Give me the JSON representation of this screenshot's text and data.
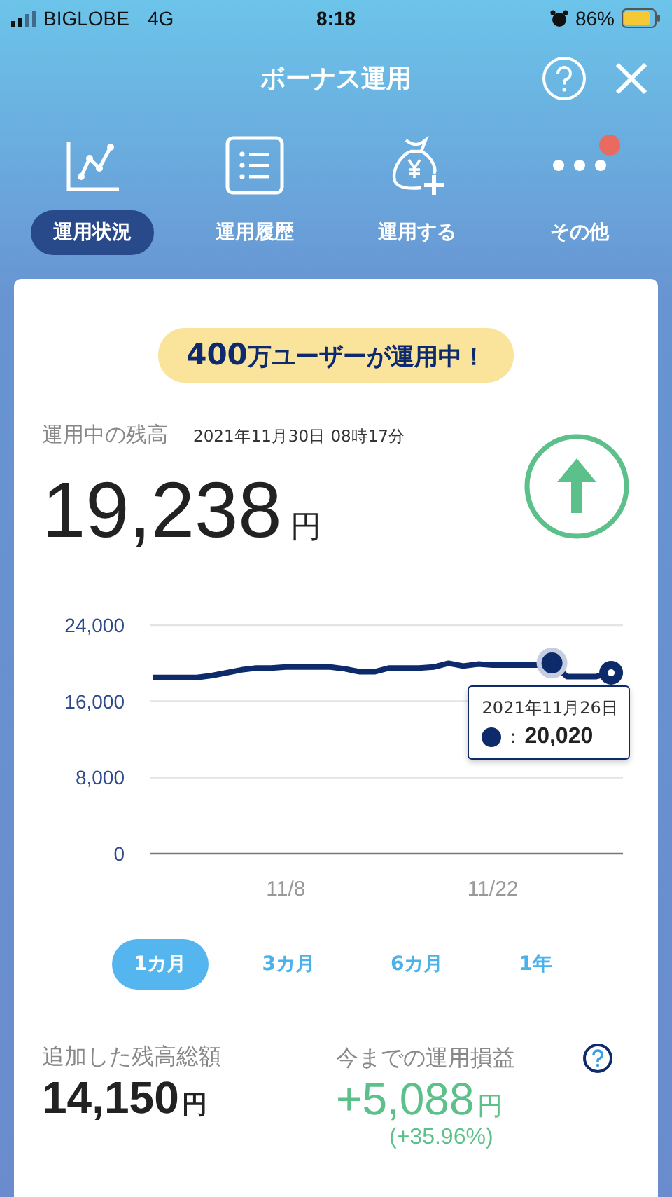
{
  "status_bar": {
    "carrier": "BIGLOBE",
    "network": "4G",
    "time": "8:18",
    "battery": "86%"
  },
  "header": {
    "title": "ボーナス運用"
  },
  "nav": [
    {
      "label": "運用状況",
      "kind": "chart",
      "selected": true,
      "notification": false
    },
    {
      "label": "運用履歴",
      "kind": "list",
      "selected": false,
      "notification": false
    },
    {
      "label": "運用する",
      "kind": "moneybag",
      "selected": false,
      "notification": false
    },
    {
      "label": "その他",
      "kind": "more",
      "selected": false,
      "notification": true
    }
  ],
  "banner": "**400**万ユーザーが運用中！",
  "balance": {
    "label": "運用中の残高",
    "timestamp": "2021年11月30日 08時17分",
    "amount": "19,238",
    "unit": "円"
  },
  "chart": {
    "chart_data": {
      "type": "line",
      "categories": [
        null,
        null,
        null,
        null,
        null,
        null,
        null,
        null,
        null,
        "11/8",
        null,
        null,
        null,
        null,
        null,
        null,
        null,
        null,
        null,
        null,
        null,
        null,
        null,
        "11/22",
        null,
        null,
        null,
        null,
        null,
        null,
        null,
        null
      ],
      "series": [
        {
          "color": "#0d2a6b",
          "values": [
            18500,
            18500,
            18500,
            18500,
            18700,
            19000,
            19300,
            19500,
            19500,
            19600,
            19600,
            19600,
            19600,
            19400,
            19100,
            19100,
            19500,
            19500,
            19500,
            19600,
            20000,
            19700,
            19900,
            19800,
            19800,
            19800,
            19800,
            20020,
            18600,
            18600,
            18600,
            19000
          ]
        }
      ],
      "ylim": [
        0,
        24000
      ],
      "yticks": [
        {
          "value": 0,
          "label": "0"
        },
        {
          "value": 8000,
          "label": "8,000"
        },
        {
          "value": 16000,
          "label": "16,000"
        },
        {
          "value": 24000,
          "label": "24,000"
        }
      ]
    },
    "tooltip": {
      "date": "2021年11月26日",
      "separator": ":",
      "value": "20,020"
    }
  },
  "periods": [
    {
      "label": "1カ月",
      "selected": true
    },
    {
      "label": "3カ月",
      "selected": false
    },
    {
      "label": "6カ月",
      "selected": false
    },
    {
      "label": "1年",
      "selected": false
    }
  ],
  "stats": [
    {
      "label": "追加した残高総額",
      "amount": "14,150",
      "unit": "円",
      "kind": "plain",
      "help": false
    },
    {
      "label": "今までの運用損益",
      "amount": "+5,088",
      "unit": "円",
      "change": "(+35.96%)",
      "kind": "gain",
      "help": true
    }
  ]
}
